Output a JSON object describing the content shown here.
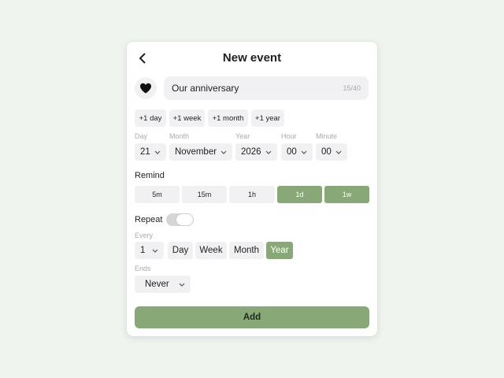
{
  "header": {
    "title": "New event"
  },
  "event": {
    "icon": "heart-icon",
    "name_value": "Our anniversary",
    "char_count": "15/40"
  },
  "quick_add": [
    "+1 day",
    "+1 week",
    "+1 month",
    "+1 year"
  ],
  "date": {
    "labels": {
      "day": "Day",
      "month": "Month",
      "year": "Year",
      "hour": "Hour",
      "minute": "Minute"
    },
    "values": {
      "day": "21",
      "month": "November",
      "year": "2026",
      "hour": "00",
      "minute": "00"
    }
  },
  "remind": {
    "label": "Remind",
    "options": [
      "5m",
      "15m",
      "1h",
      "1d",
      "1w"
    ],
    "selected": [
      "1d",
      "1w"
    ]
  },
  "repeat": {
    "label": "Repeat",
    "enabled": false,
    "every_label": "Every",
    "every_value": "1",
    "units": [
      "Day",
      "Week",
      "Month",
      "Year"
    ],
    "selected_unit": "Year",
    "ends_label": "Ends",
    "ends_value": "Never"
  },
  "actions": {
    "add_label": "Add"
  },
  "colors": {
    "accent": "#88a877",
    "page_background": "#f0f4ef",
    "chip_background": "#f1f1f3"
  }
}
